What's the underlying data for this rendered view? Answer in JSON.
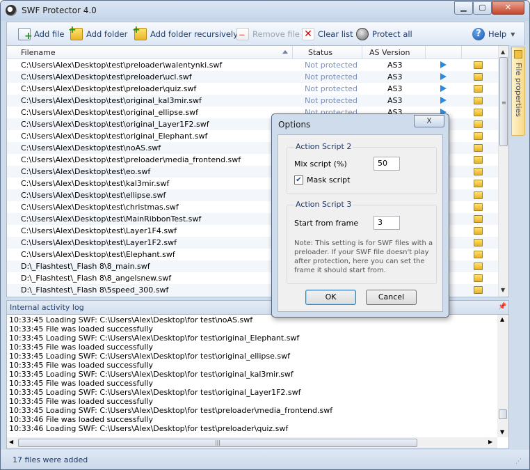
{
  "window": {
    "title": "SWF Protector 4.0"
  },
  "toolbar": {
    "add_file": "Add file",
    "add_folder": "Add folder",
    "add_folder_recursively": "Add folder recursively",
    "remove_file": "Remove file",
    "clear_list": "Clear list",
    "protect_all": "Protect all",
    "help": "Help"
  },
  "file_list": {
    "columns": {
      "filename": "Filename",
      "status": "Status",
      "as_version": "AS Version"
    },
    "rows": [
      {
        "filename": "C:\\Users\\Alex\\Desktop\\test\\preloader\\walentynki.swf",
        "status": "Not protected",
        "as": "AS3"
      },
      {
        "filename": "C:\\Users\\Alex\\Desktop\\test\\preloader\\ucl.swf",
        "status": "Not protected",
        "as": "AS3"
      },
      {
        "filename": "C:\\Users\\Alex\\Desktop\\test\\preloader\\quiz.swf",
        "status": "Not protected",
        "as": "AS3"
      },
      {
        "filename": "C:\\Users\\Alex\\Desktop\\test\\original_kal3mir.swf",
        "status": "Not protected",
        "as": "AS3"
      },
      {
        "filename": "C:\\Users\\Alex\\Desktop\\test\\original_ellipse.swf",
        "status": "Not protected",
        "as": "AS3"
      },
      {
        "filename": "C:\\Users\\Alex\\Desktop\\test\\original_Layer1F2.swf",
        "status": "",
        "as": ""
      },
      {
        "filename": "C:\\Users\\Alex\\Desktop\\test\\original_Elephant.swf",
        "status": "",
        "as": ""
      },
      {
        "filename": "C:\\Users\\Alex\\Desktop\\test\\noAS.swf",
        "status": "",
        "as": ""
      },
      {
        "filename": "C:\\Users\\Alex\\Desktop\\test\\preloader\\media_frontend.swf",
        "status": "",
        "as": ""
      },
      {
        "filename": "C:\\Users\\Alex\\Desktop\\test\\eo.swf",
        "status": "",
        "as": ""
      },
      {
        "filename": "C:\\Users\\Alex\\Desktop\\test\\kal3mir.swf",
        "status": "",
        "as": ""
      },
      {
        "filename": "C:\\Users\\Alex\\Desktop\\test\\ellipse.swf",
        "status": "",
        "as": ""
      },
      {
        "filename": "C:\\Users\\Alex\\Desktop\\test\\christmas.swf",
        "status": "",
        "as": ""
      },
      {
        "filename": "C:\\Users\\Alex\\Desktop\\test\\MainRibbonTest.swf",
        "status": "",
        "as": ""
      },
      {
        "filename": "C:\\Users\\Alex\\Desktop\\test\\Layer1F4.swf",
        "status": "",
        "as": ""
      },
      {
        "filename": "C:\\Users\\Alex\\Desktop\\test\\Layer1F2.swf",
        "status": "",
        "as": ""
      },
      {
        "filename": "C:\\Users\\Alex\\Desktop\\test\\Elephant.swf",
        "status": "",
        "as": ""
      },
      {
        "filename": "D:\\_Flashtest\\_Flash 8\\8_main.swf",
        "status": "",
        "as": ""
      },
      {
        "filename": "D:\\_Flashtest\\_Flash 8\\8_angelsnew.swf",
        "status": "",
        "as": ""
      },
      {
        "filename": "D:\\_Flashtest\\_Flash 8\\5speed_300.swf",
        "status": "",
        "as": ""
      }
    ]
  },
  "side_panel": {
    "label": "File properties"
  },
  "log": {
    "title": "Internal activity log",
    "lines": [
      "10:33:45 Loading SWF: C:\\Users\\Alex\\Desktop\\for test\\noAS.swf",
      "10:33:45 File was loaded successfully",
      "10:33:45 Loading SWF: C:\\Users\\Alex\\Desktop\\for test\\original_Elephant.swf",
      "10:33:45 File was loaded successfully",
      "10:33:45 Loading SWF: C:\\Users\\Alex\\Desktop\\for test\\original_ellipse.swf",
      "10:33:45 File was loaded successfully",
      "10:33:45 Loading SWF: C:\\Users\\Alex\\Desktop\\for test\\original_kal3mir.swf",
      "10:33:45 File was loaded successfully",
      "10:33:45 Loading SWF: C:\\Users\\Alex\\Desktop\\for test\\original_Layer1F2.swf",
      "10:33:45 File was loaded successfully",
      "10:33:45 Loading SWF: C:\\Users\\Alex\\Desktop\\for test\\preloader\\media_frontend.swf",
      "10:33:46 File was loaded successfully",
      "10:33:46 Loading SWF: C:\\Users\\Alex\\Desktop\\for test\\preloader\\quiz.swf"
    ]
  },
  "status_bar": {
    "text": "17 files were added"
  },
  "dialog": {
    "title": "Options",
    "close_label": "X",
    "as2": {
      "title": "Action Script 2",
      "mix_label": "Mix script (%)",
      "mix_value": "50",
      "mask_label": "Mask script",
      "mask_checked": true
    },
    "as3": {
      "title": "Action Script 3",
      "start_label": "Start from frame",
      "start_value": "3",
      "note": "Note: This setting is for SWF files with a preloader. If your SWF file doesn't play after protection, here you  can set the frame it should start from."
    },
    "ok_label": "OK",
    "cancel_label": "Cancel"
  }
}
